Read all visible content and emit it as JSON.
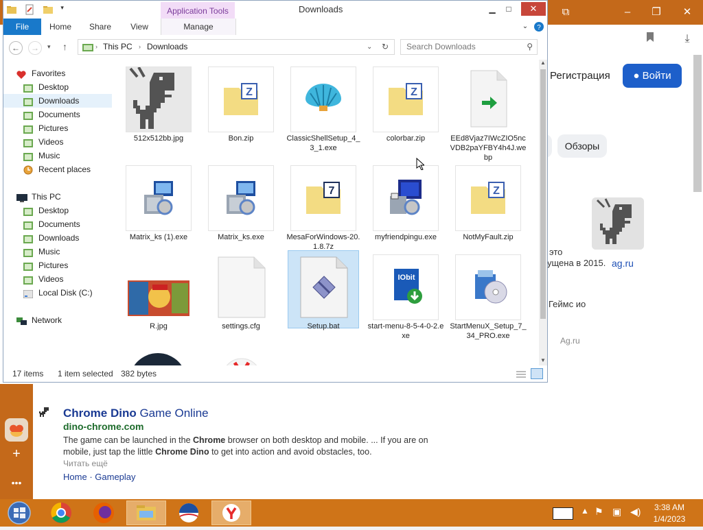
{
  "browser": {
    "register_label": "Регистрация",
    "login_label": "Войти",
    "chip_reviews": "Обзоры",
    "right_card_line1": "это",
    "right_card_line2": "ущена в 2015.",
    "right_card_link": "ag.ru",
    "right_card_line3": "Геймс ио",
    "right_card_line4": "Ag.ru",
    "result": {
      "title_strong": "Chrome Dino",
      "title_rest": " Game Online",
      "url": "dino-chrome.com",
      "snippet_parts": [
        "The game can be launched in the ",
        "Chrome",
        " browser on both desktop and mobile. ... If you are on mobile, just tap the little ",
        "Chrome Dino",
        " to get into action and avoid obstacles, too."
      ],
      "read_more": "Читать ещё",
      "link_home": "Home",
      "link_separator": "·",
      "link_gameplay": "Gameplay"
    }
  },
  "explorer": {
    "title": "Downloads",
    "app_tools_label": "Application Tools",
    "tabs": {
      "file": "File",
      "home": "Home",
      "share": "Share",
      "view": "View",
      "manage": "Manage"
    },
    "breadcrumb": [
      "This PC",
      "Downloads"
    ],
    "search_placeholder": "Search Downloads",
    "nav": {
      "favorites": "Favorites",
      "fav_desktop": "Desktop",
      "fav_downloads": "Downloads",
      "fav_documents": "Documents",
      "fav_pictures": "Pictures",
      "fav_videos": "Videos",
      "fav_music": "Music",
      "fav_recent": "Recent places",
      "this_pc": "This PC",
      "pc_desktop": "Desktop",
      "pc_documents": "Documents",
      "pc_downloads": "Downloads",
      "pc_music": "Music",
      "pc_pictures": "Pictures",
      "pc_videos": "Videos",
      "pc_disk": "Local Disk (C:)",
      "network": "Network"
    },
    "files": [
      {
        "name": "512x512bb.jpg",
        "icon": "dino-image"
      },
      {
        "name": "Bon.zip",
        "icon": "zip-folder"
      },
      {
        "name": "ClassicShellSetup_4_3_1.exe",
        "icon": "shell"
      },
      {
        "name": "colorbar.zip",
        "icon": "zip-folder"
      },
      {
        "name": "EEd8Vjaz7IWcZIO5ncVDB2paYFBY4h4J.webp",
        "icon": "webp-file"
      },
      {
        "name": "Matrix_ks (1).exe",
        "icon": "installer"
      },
      {
        "name": "Matrix_ks.exe",
        "icon": "installer"
      },
      {
        "name": "MesaForWindows-20.1.8.7z",
        "icon": "7z-folder"
      },
      {
        "name": "myfriendpingu.exe",
        "icon": "installer"
      },
      {
        "name": "NotMyFault.zip",
        "icon": "zip-folder"
      },
      {
        "name": "R.jpg",
        "icon": "photo"
      },
      {
        "name": "settings.cfg",
        "icon": "blank-file"
      },
      {
        "name": "Setup.bat",
        "icon": "bat-file"
      },
      {
        "name": "start-menu-8-5-4-0-2.exe",
        "icon": "iobit"
      },
      {
        "name": "StartMenuX_Setup_7_34_PRO.exe",
        "icon": "cd-installer"
      }
    ],
    "status": {
      "items": "17 items",
      "selected": "1 item selected",
      "size": "382 bytes"
    }
  },
  "taskbar": {
    "time": "3:38 AM",
    "date": "1/4/2023"
  },
  "colors": {
    "accent_orange": "#cf7418",
    "ribbon_blue": "#1979ca",
    "selection": "#cce4f7",
    "login_blue": "#1d5fca"
  }
}
